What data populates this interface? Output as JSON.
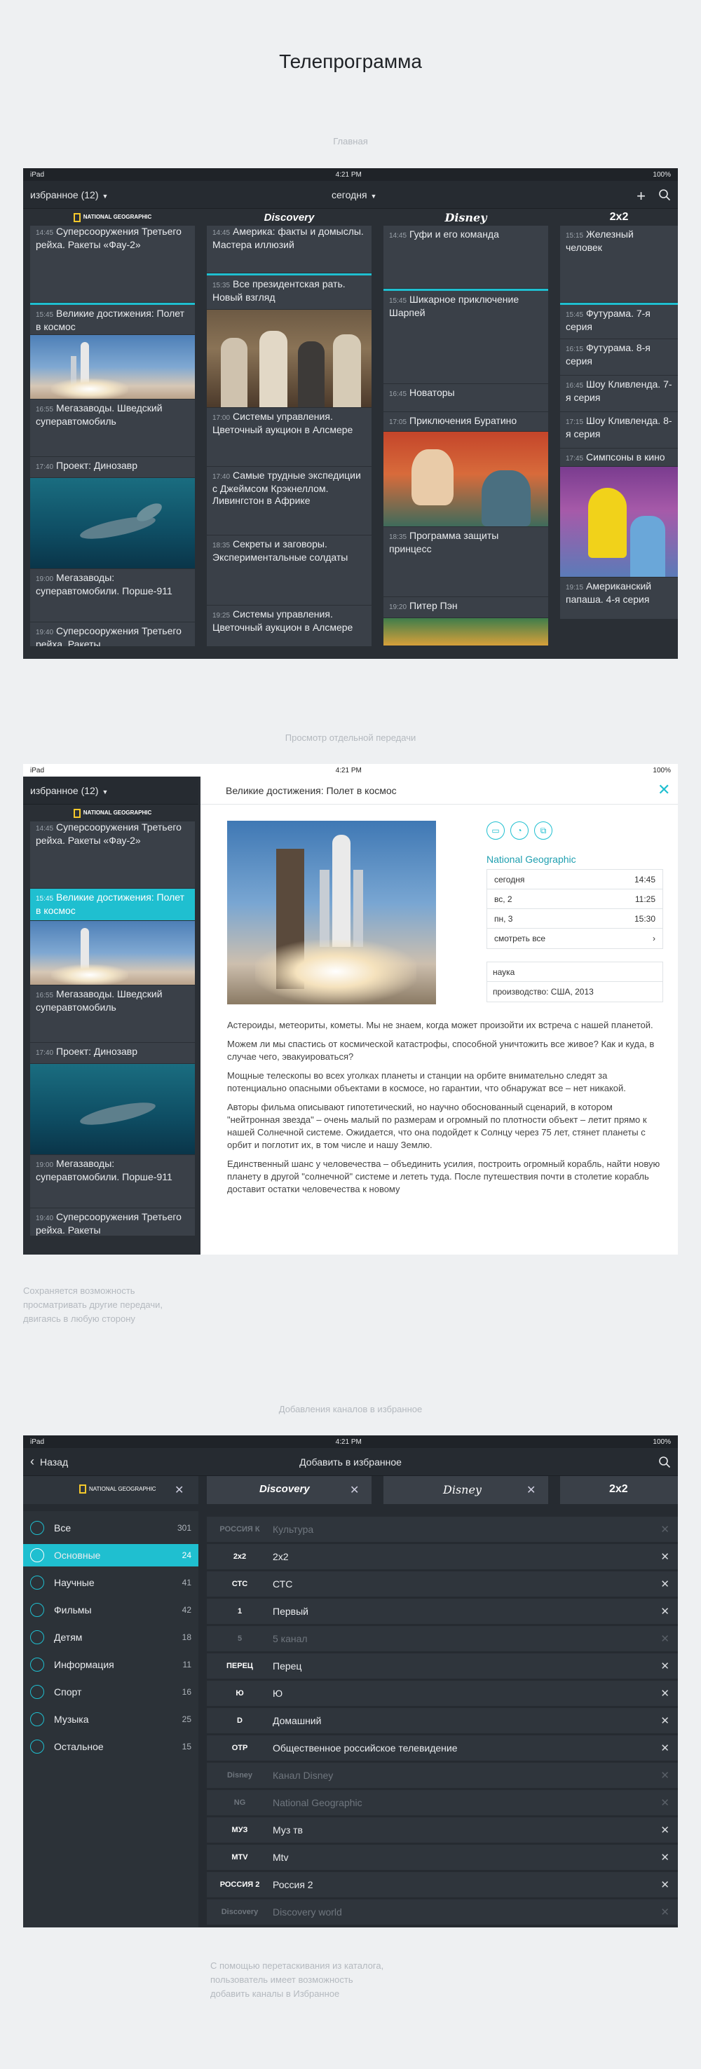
{
  "page_title": "Телепрограмма",
  "captions": {
    "main": "Главная",
    "detail": "Просмотр отдельной передачи",
    "favorites": "Добавления каналов в избранное"
  },
  "notes": {
    "detail_1": "Сохраняется возможность",
    "detail_2": "просматривать другие передачи,",
    "detail_3": "двигаясь в любую сторону",
    "fav_1": "С помощью перетаскивания из каталога,",
    "fav_2": "пользователь имеет возможность",
    "fav_3": "добавить каналы в Избранное"
  },
  "status": {
    "device": "iPad",
    "time": "4:21 PM",
    "battery": "100%"
  },
  "screen1": {
    "favorites": "избранное (12)",
    "day": "сегодня",
    "channels": [
      "NATIONAL GEOGRAPHIC",
      "Discovery",
      "Disney",
      "2x2"
    ],
    "col1": [
      {
        "time": "14:45",
        "title": "Суперсооружения Третьего рейха. Ракеты «Фау-2»"
      },
      {
        "time": "15:45",
        "title": "Великие достижения: Полет в космос"
      },
      {
        "time": "16:55",
        "title": "Мегазаводы. Шведский суперавтомобиль"
      },
      {
        "time": "17:40",
        "title": "Проект: Динозавр"
      },
      {
        "time": "19:00",
        "title": "Мегазаводы: суперавтомобили. Порше-911"
      },
      {
        "time": "19:40",
        "title": "Суперсооружения Третьего рейха. Ракеты"
      }
    ],
    "col2": [
      {
        "time": "14:45",
        "title": "Америка: факты и домыслы. Мастера иллюзий"
      },
      {
        "time": "15:35",
        "title": "Все президентская рать. Новый взгляд"
      },
      {
        "time": "17:00",
        "title": "Системы управления. Цветочный аукцион в Алсмере"
      },
      {
        "time": "17:40",
        "title": "Самые трудные экспедиции с Джеймсом Крэкнеллом. Ливингстон в Африке"
      },
      {
        "time": "18:35",
        "title": "Секреты и заговоры. Экспериментальные солдаты"
      },
      {
        "time": "19:25",
        "title": "Системы управления. Цветочный аукцион в Алсмере"
      }
    ],
    "col3": [
      {
        "time": "14:45",
        "title": "Гуфи и его команда"
      },
      {
        "time": "15:45",
        "title": "Шикарное приключение Шарпей"
      },
      {
        "time": "16:45",
        "title": "Новаторы"
      },
      {
        "time": "17:05",
        "title": "Приключения Буратино"
      },
      {
        "time": "18:35",
        "title": "Программа защиты принцесс"
      },
      {
        "time": "19:20",
        "title": "Питер Пэн"
      }
    ],
    "col4": [
      {
        "time": "15:15",
        "title": "Железный человек"
      },
      {
        "time": "15:45",
        "title": "Футурама. 7-я серия"
      },
      {
        "time": "16:15",
        "title": "Футурама. 8-я серия"
      },
      {
        "time": "16:45",
        "title": "Шоу Кливленда. 7-я серия"
      },
      {
        "time": "17:15",
        "title": "Шоу Кливленда. 8-я серия"
      },
      {
        "time": "17:45",
        "title": "Симпсоны в кино"
      },
      {
        "time": "19:15",
        "title": "Американский папаша. 4-я серия"
      }
    ]
  },
  "screen2": {
    "favorites": "избранное (12)",
    "title": "Великие достижения: Полет в космос",
    "channel": "National Geographic",
    "schedule": [
      {
        "day": "сегодня",
        "time": "14:45"
      },
      {
        "day": "вс, 2",
        "time": "11:25"
      },
      {
        "day": "пн, 3",
        "time": "15:30"
      }
    ],
    "see_all": "смотреть все",
    "genre": "наука",
    "production": "производство: США, 2013",
    "paragraphs": [
      "Астероиды, метеориты, кометы. Мы не знаем, когда может произойти их встреча с нашей планетой.",
      "Можем ли мы спастись от космической катастрофы, способной уничтожить все живое? Как и куда, в случае чего, эвакуироваться?",
      "Мощные телескопы во всех уголках планеты и станции на орбите внимательно следят за потенциально опасными объектами в космосе, но гарантии, что обнаружат все – нет никакой.",
      "Авторы фильма описывают гипотетический, но научно обоснованный сценарий, в котором \"нейтронная звезда\" – очень малый по размерам и огромный по плотности объект – летит прямо к нашей Солнечной системе. Ожидается, что она подойдет к Солнцу через 75 лет, стянет планеты с орбит и поглотит их, в том числе и нашу Землю.",
      "Единственный шанс у человечества – объединить усилия, построить огромный корабль, найти новую планету в другой \"солнечной\" системе и лететь туда. После путешествия почти в столетие корабль доставит остатки человечества к новому"
    ],
    "list": [
      {
        "time": "14:45",
        "title": "Суперсооружения Третьего рейха. Ракеты «Фау-2»"
      },
      {
        "time": "15:45",
        "title": "Великие достижения: Полет в космос"
      },
      {
        "time": "16:55",
        "title": "Мегазаводы. Шведский суперавтомобиль"
      },
      {
        "time": "17:40",
        "title": "Проект: Динозавр"
      },
      {
        "time": "19:00",
        "title": "Мегазаводы: суперавтомобили. Порше-911"
      },
      {
        "time": "19:40",
        "title": "Суперсооружения Третьего рейха. Ракеты"
      }
    ]
  },
  "screen3": {
    "back": "Назад",
    "title": "Добавить в избранное",
    "categories": [
      {
        "label": "Все",
        "count": "301"
      },
      {
        "label": "Основные",
        "count": "24"
      },
      {
        "label": "Научные",
        "count": "41"
      },
      {
        "label": "Фильмы",
        "count": "42"
      },
      {
        "label": "Детям",
        "count": "18"
      },
      {
        "label": "Информация",
        "count": "11"
      },
      {
        "label": "Спорт",
        "count": "16"
      },
      {
        "label": "Музыка",
        "count": "25"
      },
      {
        "label": "Остальное",
        "count": "15"
      }
    ],
    "channels": [
      {
        "logo": "РОССИЯ К",
        "name": "Культура",
        "dim": true
      },
      {
        "logo": "2x2",
        "name": "2x2",
        "dim": false
      },
      {
        "logo": "СТС",
        "name": "СТС",
        "dim": false
      },
      {
        "logo": "1",
        "name": "Первый",
        "dim": false
      },
      {
        "logo": "5",
        "name": "5 канал",
        "dim": true
      },
      {
        "logo": "ПЕРЕЦ",
        "name": "Перец",
        "dim": false
      },
      {
        "logo": "Ю",
        "name": "Ю",
        "dim": false
      },
      {
        "logo": "D",
        "name": "Домашний",
        "dim": false
      },
      {
        "logo": "ОТР",
        "name": "Общественное российское телевидение",
        "dim": false
      },
      {
        "logo": "Disney",
        "name": "Канал Disney",
        "dim": true
      },
      {
        "logo": "NG",
        "name": "National Geographic",
        "dim": true
      },
      {
        "logo": "МУЗ",
        "name": "Муз тв",
        "dim": false
      },
      {
        "logo": "MTV",
        "name": "Mtv",
        "dim": false
      },
      {
        "logo": "РОССИЯ 2",
        "name": "Россия 2",
        "dim": false
      },
      {
        "logo": "Discovery",
        "name": "Discovery world",
        "dim": true
      }
    ]
  },
  "colors": {
    "accent": "#1fbfd0",
    "dark": "#2a2f35",
    "cell": "#3a4048"
  }
}
